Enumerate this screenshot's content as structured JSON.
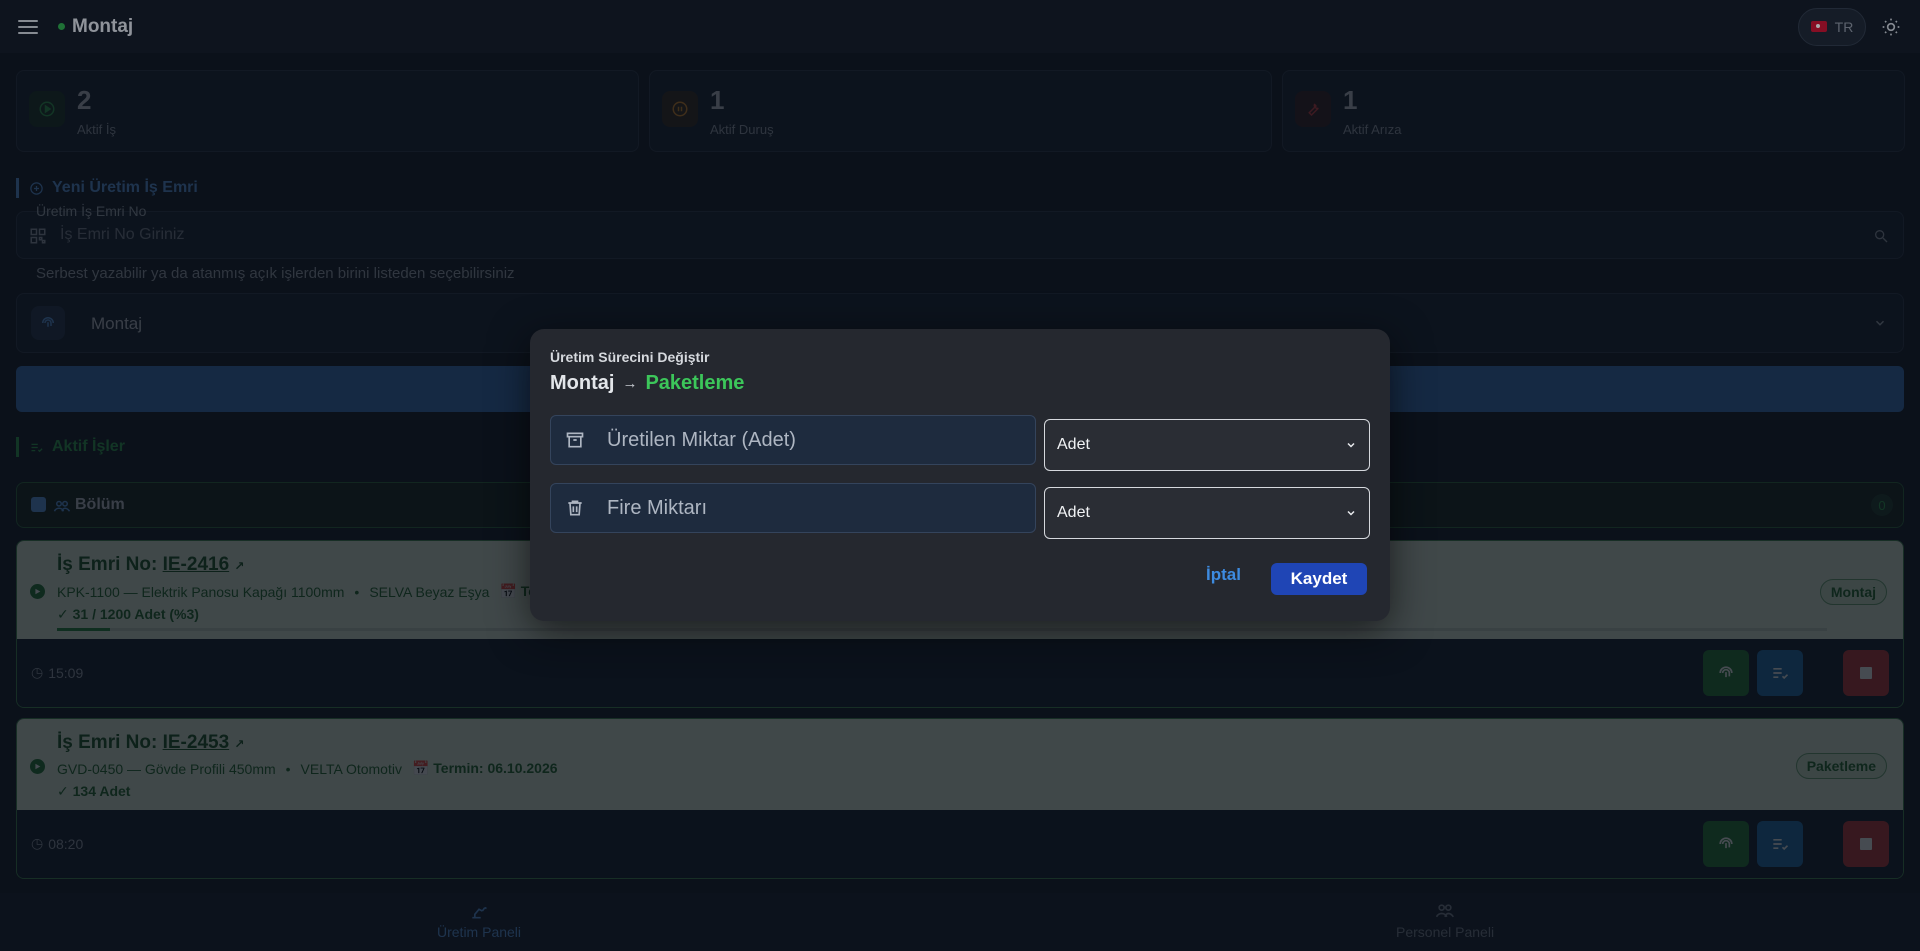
{
  "topbar": {
    "title": "Montaj",
    "lang": "TR"
  },
  "stats": [
    {
      "value": "2",
      "label": "Aktif İş",
      "icon": "play-circle-icon",
      "color": "#2ba84a"
    },
    {
      "value": "1",
      "label": "Aktif Duruş",
      "icon": "pause-circle-icon",
      "color": "#e08a1e"
    },
    {
      "value": "1",
      "label": "Aktif Arıza",
      "icon": "wrench-icon",
      "color": "#d63b3b"
    }
  ],
  "new_order": {
    "title": "Yeni Üretim İş Emri",
    "field_label": "Üretim İş Emri No",
    "placeholder": "İş Emri No Giriniz",
    "hint": "Serbest yazabilir ya da atanmış açık işlerden birini listeden seçebilirsiniz",
    "process_value": "Montaj"
  },
  "active_jobs": {
    "title": "Aktif İşler",
    "filter_label": "Bölüm",
    "filter_count": "0",
    "jobs": [
      {
        "title_prefix": "İş Emri No:",
        "order_no": "IE-2416",
        "product": "KPK-1100 — Elektrik Panosu Kapağı 1100mm",
        "customer": "SELVA Beyaz Eşya",
        "due": "Term",
        "qty": "31 / 1200 Adet",
        "pct": "(%3)",
        "progress": 0.03,
        "badge": "Montaj",
        "time": "15:09"
      },
      {
        "title_prefix": "İş Emri No:",
        "order_no": "IE-2453",
        "product": "GVD-0450 — Gövde Profili 450mm",
        "customer": "VELTA Otomotiv",
        "due": "Termin: 06.10.2026",
        "qty": "134 Adet",
        "badge": "Paketleme",
        "time": "08:20"
      }
    ]
  },
  "bottom_nav": {
    "production": "Üretim Paneli",
    "personnel": "Personel Paneli"
  },
  "modal": {
    "subtitle": "Üretim Sürecini Değiştir",
    "from": "Montaj",
    "to": "Paketleme",
    "produced_placeholder": "Üretilen Miktar (Adet)",
    "scrap_placeholder": "Fire Miktarı",
    "unit1": "Adet",
    "unit2": "Adet",
    "cancel": "İptal",
    "save": "Kaydet"
  },
  "colors": {
    "accent_green": "#3cc65a",
    "accent_blue": "#1f45b5",
    "danger": "#d63b3b"
  }
}
